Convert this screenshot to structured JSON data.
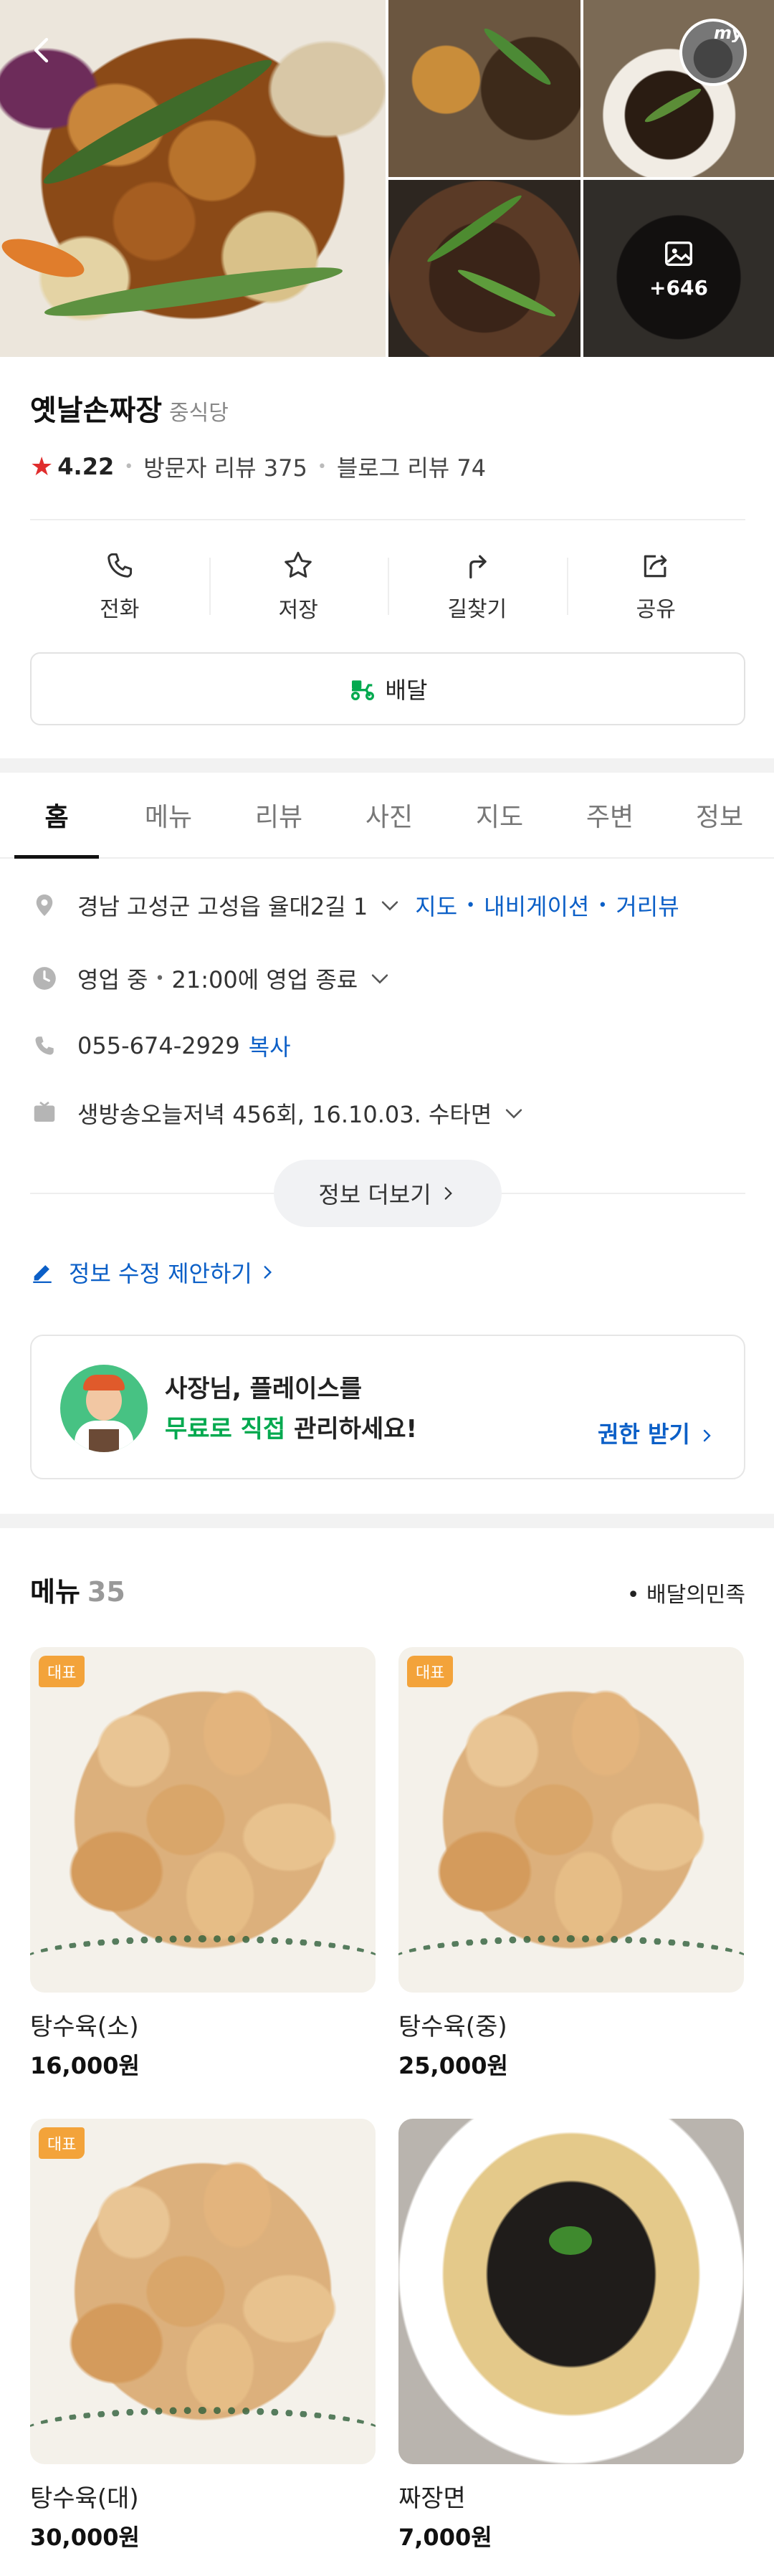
{
  "hero": {
    "photo_more_count": "+646",
    "avatar_label": "my"
  },
  "place": {
    "name": "옛날손짜장",
    "category": "중식당",
    "rating": "4.22",
    "visitor_reviews": "방문자 리뷰 375",
    "blog_reviews": "블로그 리뷰 74"
  },
  "actions": {
    "call": "전화",
    "save": "저장",
    "directions": "길찾기",
    "share": "공유",
    "delivery": "배달"
  },
  "tabs": [
    "홈",
    "메뉴",
    "리뷰",
    "사진",
    "지도",
    "주변",
    "정보"
  ],
  "info": {
    "address": "경남 고성군 고성읍 율대2길 1",
    "map_link": "지도",
    "navigation_link": "내비게이션",
    "street_view_link": "거리뷰",
    "status": "영업 중",
    "hours": "21:00에 영업 종료",
    "phone": "055-674-2929",
    "copy_label": "복사",
    "tv_info": "생방송오늘저녁 456회, 16.10.03. 수타면",
    "more_label": "정보 더보기",
    "suggest_edit": "정보 수정 제안하기"
  },
  "owner_card": {
    "line1": "사장님, 플레이스를",
    "line2_highlight": "무료로 직접",
    "line2_rest": " 관리하세요!",
    "cta": "권한 받기"
  },
  "menu": {
    "title": "메뉴",
    "count": "35",
    "source": "• 배달의민족",
    "items": [
      {
        "name": "탕수육(소)",
        "price": "16,000원",
        "badge": "대표"
      },
      {
        "name": "탕수육(중)",
        "price": "25,000원",
        "badge": "대표"
      },
      {
        "name": "탕수육(대)",
        "price": "30,000원",
        "badge": "대표"
      },
      {
        "name": "짜장면",
        "price": "7,000원",
        "badge": ""
      }
    ]
  },
  "colors": {
    "link_blue": "#0b5fc7",
    "star_red": "#e02d2d",
    "badge_orange": "#f3a33a",
    "green": "#03a94f"
  }
}
